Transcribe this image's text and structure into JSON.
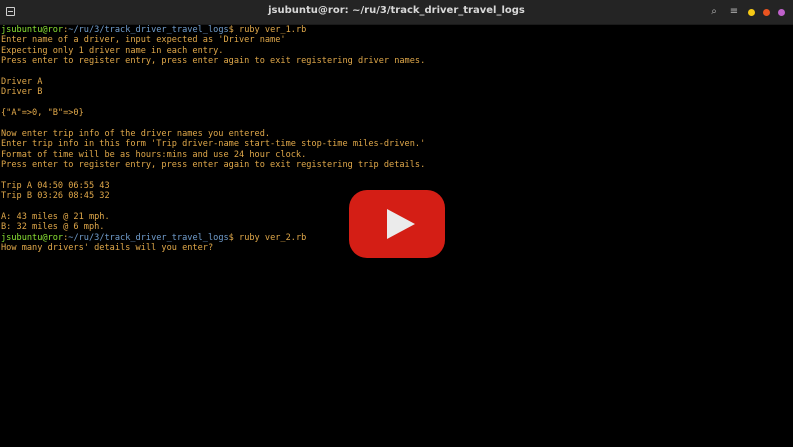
{
  "window": {
    "title": "jsubuntu@ror: ~/ru/3/track_driver_travel_logs",
    "actions": [
      {
        "name": "search-icon",
        "glyph": "⌕"
      },
      {
        "name": "menu-icon",
        "glyph": "≡"
      }
    ],
    "controls": [
      {
        "name": "minimize-button",
        "color": "#f6c915"
      },
      {
        "name": "maximize-button",
        "color": "#e95420"
      },
      {
        "name": "close-button",
        "color": "#c061cb"
      }
    ]
  },
  "terminal": {
    "lines": [
      {
        "type": "prompt",
        "user": "jsubuntu@ror",
        "path": "~/ru/3/track_driver_travel_logs",
        "cmd": "ruby ver_1.rb"
      },
      {
        "type": "out",
        "text": "Enter name of a driver, input expected as 'Driver name'"
      },
      {
        "type": "out",
        "text": "Expecting only 1 driver name in each entry."
      },
      {
        "type": "out",
        "text": "Press enter to register entry, press enter again to exit registering driver names."
      },
      {
        "type": "out",
        "text": ""
      },
      {
        "type": "out",
        "text": "Driver A"
      },
      {
        "type": "out",
        "text": "Driver B"
      },
      {
        "type": "out",
        "text": ""
      },
      {
        "type": "out",
        "text": "{\"A\"=>0, \"B\"=>0}"
      },
      {
        "type": "out",
        "text": ""
      },
      {
        "type": "out",
        "text": "Now enter trip info of the driver names you entered."
      },
      {
        "type": "out",
        "text": "Enter trip info in this form 'Trip driver-name start-time stop-time miles-driven.'"
      },
      {
        "type": "out",
        "text": "Format of time will be as hours:mins and use 24 hour clock."
      },
      {
        "type": "out",
        "text": "Press enter to register entry, press enter again to exit registering trip details."
      },
      {
        "type": "out",
        "text": ""
      },
      {
        "type": "out",
        "text": "Trip A 04:50 06:55 43"
      },
      {
        "type": "out",
        "text": "Trip B 03:26 08:45 32"
      },
      {
        "type": "out",
        "text": ""
      },
      {
        "type": "out",
        "text": "A: 43 miles @ 21 mph."
      },
      {
        "type": "out",
        "text": "B: 32 miles @ 6 mph."
      },
      {
        "type": "prompt",
        "user": "jsubuntu@ror",
        "path": "~/ru/3/track_driver_travel_logs",
        "cmd": "ruby ver_2.rb"
      },
      {
        "type": "out",
        "text": "How many drivers' details will you enter?"
      }
    ]
  },
  "overlay": {
    "play_icon": "play-icon",
    "color": "#e62117"
  }
}
